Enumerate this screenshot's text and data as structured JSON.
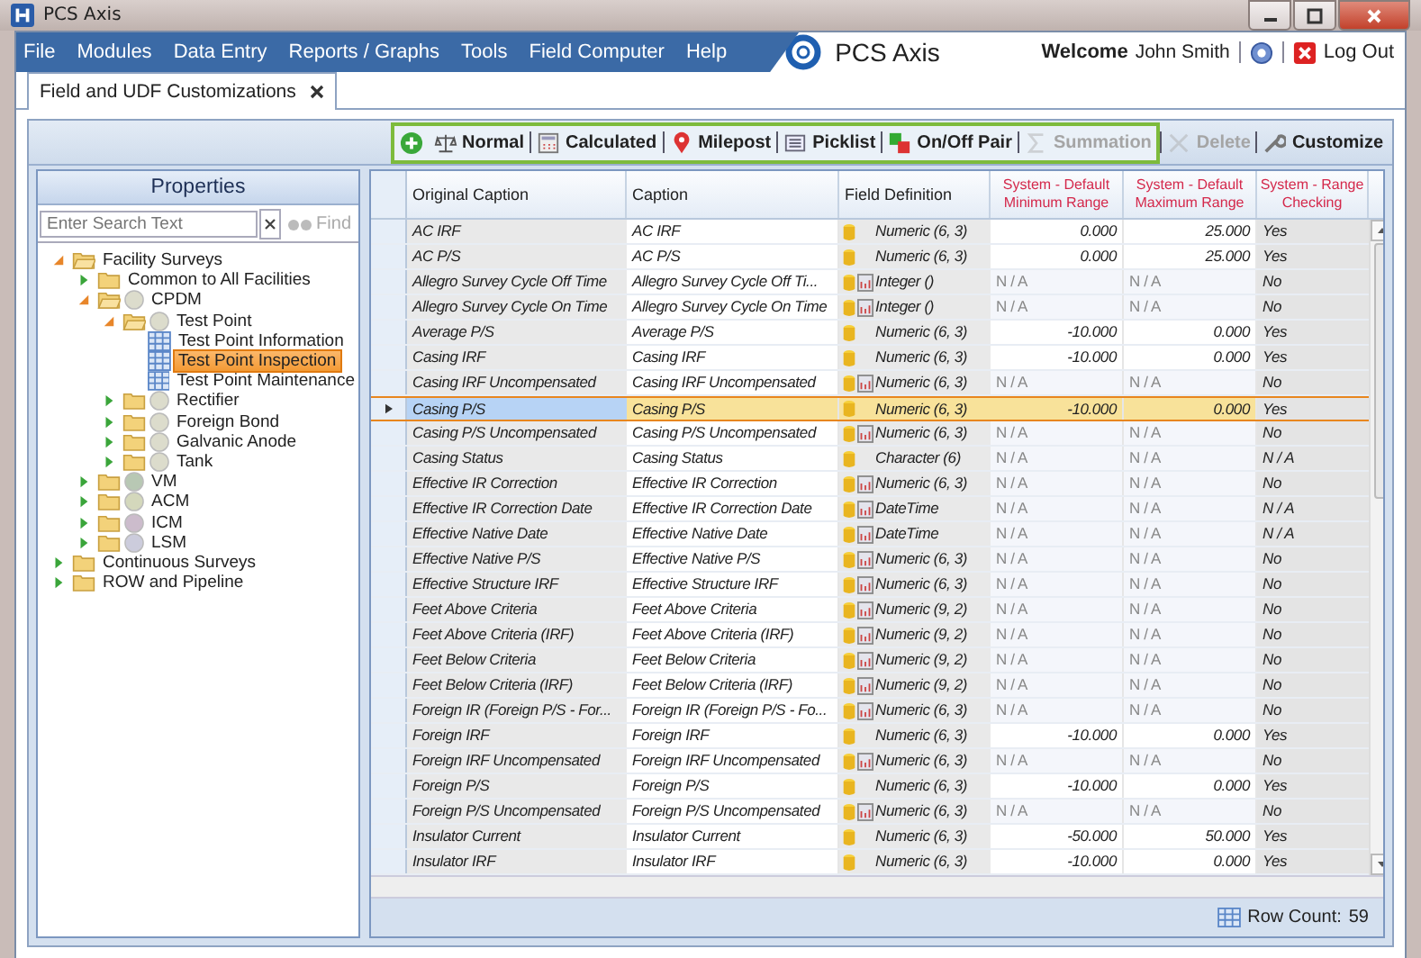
{
  "window": {
    "title": "PCS Axis"
  },
  "menu": [
    "File",
    "Modules",
    "Data Entry",
    "Reports / Graphs",
    "Tools",
    "Field Computer",
    "Help"
  ],
  "brand": "PCS Axis",
  "welcome": {
    "label": "Welcome",
    "user": "John Smith"
  },
  "logout": "Log Out",
  "tabs": [
    {
      "label": "Field and UDF Customizations",
      "selected": true
    }
  ],
  "toolbar": {
    "group": [
      {
        "kind": "add",
        "disabled": false
      },
      {
        "kind": "normal",
        "label": "Normal",
        "disabled": false
      },
      {
        "kind": "calculated",
        "label": "Calculated",
        "disabled": false
      },
      {
        "kind": "milepost",
        "label": "Milepost",
        "disabled": false
      },
      {
        "kind": "picklist",
        "label": "Picklist",
        "disabled": false
      },
      {
        "kind": "onoff",
        "label": "On/Off Pair",
        "disabled": false
      },
      {
        "kind": "summation",
        "label": "Summation",
        "disabled": true
      }
    ],
    "items": [
      {
        "kind": "delete",
        "label": "Delete",
        "disabled": true
      },
      {
        "kind": "customize",
        "label": "Customize",
        "disabled": false
      }
    ]
  },
  "properties": {
    "title": "Properties",
    "search": {
      "placeholder": "Enter Search Text"
    },
    "find": "Find",
    "tree": [
      {
        "label": "Facility Surveys",
        "kind": "folder",
        "expanded": true,
        "selected": false,
        "children": [
          {
            "label": "Common to All Facilities",
            "kind": "folder",
            "expanded": false,
            "selected": false
          },
          {
            "label": "CPDM",
            "kind": "folder",
            "color": "#dcdccc",
            "expanded": true,
            "selected": false,
            "children": [
              {
                "label": "Test Point",
                "kind": "folder",
                "color": "#dcdccc",
                "expanded": true,
                "selected": false,
                "children": [
                  {
                    "label": "Test Point Information",
                    "kind": "table",
                    "selected": false
                  },
                  {
                    "label": "Test Point Inspection",
                    "kind": "table",
                    "selected": true
                  },
                  {
                    "label": "Test Point Maintenance",
                    "kind": "table",
                    "selected": false
                  }
                ]
              },
              {
                "label": "Rectifier",
                "kind": "folder",
                "color": "#dcdccc",
                "expanded": false,
                "selected": false
              },
              {
                "label": "Foreign Bond",
                "kind": "folder",
                "color": "#dcdccc",
                "expanded": false,
                "selected": false
              },
              {
                "label": "Galvanic Anode",
                "kind": "folder",
                "color": "#dcdccc",
                "expanded": false,
                "selected": false
              },
              {
                "label": "Tank",
                "kind": "folder",
                "color": "#dcdccc",
                "expanded": false,
                "selected": false
              }
            ]
          },
          {
            "label": "VM",
            "kind": "folder",
            "color": "#b8c8b4",
            "expanded": false,
            "selected": false
          },
          {
            "label": "ACM",
            "kind": "folder",
            "color": "#d4d8bc",
            "expanded": false,
            "selected": false
          },
          {
            "label": "ICM",
            "kind": "folder",
            "color": "#ccbccc",
            "expanded": false,
            "selected": false
          },
          {
            "label": "LSM",
            "kind": "folder",
            "color": "#ccccdc",
            "expanded": false,
            "selected": false
          }
        ]
      },
      {
        "label": "Continuous Surveys",
        "kind": "folder",
        "expanded": false,
        "selected": false
      },
      {
        "label": "ROW and Pipeline",
        "kind": "folder",
        "expanded": false,
        "selected": false
      }
    ]
  },
  "grid": {
    "columns": [
      {
        "label": "Original Caption",
        "system": false
      },
      {
        "label": "Caption",
        "system": false
      },
      {
        "label": "Field Definition",
        "system": false
      },
      {
        "label": "System - Default Minimum Range",
        "system": true
      },
      {
        "label": "System - Default Maximum Range",
        "system": true
      },
      {
        "label": "System - Range Checking",
        "system": true
      }
    ],
    "rows": [
      {
        "original": "AC IRF",
        "caption": "AC IRF",
        "definition": "Numeric (6, 3)",
        "calculated": false,
        "has_range": true,
        "min": "0.000",
        "max": "25.000",
        "check": "Yes",
        "selected": false
      },
      {
        "original": "AC P/S",
        "caption": "AC P/S",
        "definition": "Numeric (6, 3)",
        "calculated": false,
        "has_range": true,
        "min": "0.000",
        "max": "25.000",
        "check": "Yes",
        "selected": false
      },
      {
        "original": "Allegro Survey Cycle Off Time",
        "caption": "Allegro Survey Cycle Off Ti...",
        "definition": "Integer ()",
        "calculated": true,
        "has_range": false,
        "min": "N / A",
        "max": "N / A",
        "check": "No",
        "selected": false
      },
      {
        "original": "Allegro Survey Cycle On Time",
        "caption": "Allegro Survey Cycle On Time",
        "definition": "Integer ()",
        "calculated": true,
        "has_range": false,
        "min": "N / A",
        "max": "N / A",
        "check": "No",
        "selected": false
      },
      {
        "original": "Average P/S",
        "caption": "Average P/S",
        "definition": "Numeric (6, 3)",
        "calculated": false,
        "has_range": true,
        "min": "-10.000",
        "max": "0.000",
        "check": "Yes",
        "selected": false
      },
      {
        "original": "Casing IRF",
        "caption": "Casing IRF",
        "definition": "Numeric (6, 3)",
        "calculated": false,
        "has_range": true,
        "min": "-10.000",
        "max": "0.000",
        "check": "Yes",
        "selected": false
      },
      {
        "original": "Casing IRF Uncompensated",
        "caption": "Casing IRF Uncompensated",
        "definition": "Numeric (6, 3)",
        "calculated": true,
        "has_range": false,
        "min": "N / A",
        "max": "N / A",
        "check": "No",
        "selected": false
      },
      {
        "original": "Casing P/S",
        "caption": "Casing P/S",
        "definition": "Numeric (6, 3)",
        "calculated": false,
        "has_range": true,
        "min": "-10.000",
        "max": "0.000",
        "check": "Yes",
        "selected": true
      },
      {
        "original": "Casing P/S Uncompensated",
        "caption": "Casing P/S Uncompensated",
        "definition": "Numeric (6, 3)",
        "calculated": true,
        "has_range": false,
        "min": "N / A",
        "max": "N / A",
        "check": "No",
        "selected": false
      },
      {
        "original": "Casing Status",
        "caption": "Casing Status",
        "definition": "Character (6)",
        "calculated": false,
        "has_range": false,
        "min": "N / A",
        "max": "N / A",
        "check": "N / A",
        "selected": false
      },
      {
        "original": "Effective IR Correction",
        "caption": "Effective IR Correction",
        "definition": "Numeric (6, 3)",
        "calculated": true,
        "has_range": false,
        "min": "N / A",
        "max": "N / A",
        "check": "No",
        "selected": false
      },
      {
        "original": "Effective IR Correction Date",
        "caption": "Effective IR Correction Date",
        "definition": "DateTime",
        "calculated": true,
        "has_range": false,
        "min": "N / A",
        "max": "N / A",
        "check": "N / A",
        "selected": false
      },
      {
        "original": "Effective Native Date",
        "caption": "Effective Native Date",
        "definition": "DateTime",
        "calculated": true,
        "has_range": false,
        "min": "N / A",
        "max": "N / A",
        "check": "N / A",
        "selected": false
      },
      {
        "original": "Effective Native P/S",
        "caption": "Effective Native P/S",
        "definition": "Numeric (6, 3)",
        "calculated": true,
        "has_range": false,
        "min": "N / A",
        "max": "N / A",
        "check": "No",
        "selected": false
      },
      {
        "original": "Effective Structure IRF",
        "caption": "Effective Structure IRF",
        "definition": "Numeric (6, 3)",
        "calculated": true,
        "has_range": false,
        "min": "N / A",
        "max": "N / A",
        "check": "No",
        "selected": false
      },
      {
        "original": "Feet Above Criteria",
        "caption": "Feet Above Criteria",
        "definition": "Numeric (9, 2)",
        "calculated": true,
        "has_range": false,
        "min": "N / A",
        "max": "N / A",
        "check": "No",
        "selected": false
      },
      {
        "original": "Feet Above Criteria (IRF)",
        "caption": "Feet Above Criteria (IRF)",
        "definition": "Numeric (9, 2)",
        "calculated": true,
        "has_range": false,
        "min": "N / A",
        "max": "N / A",
        "check": "No",
        "selected": false
      },
      {
        "original": "Feet Below Criteria",
        "caption": "Feet Below Criteria",
        "definition": "Numeric (9, 2)",
        "calculated": true,
        "has_range": false,
        "min": "N / A",
        "max": "N / A",
        "check": "No",
        "selected": false
      },
      {
        "original": "Feet Below Criteria (IRF)",
        "caption": "Feet Below Criteria (IRF)",
        "definition": "Numeric (9, 2)",
        "calculated": true,
        "has_range": false,
        "min": "N / A",
        "max": "N / A",
        "check": "No",
        "selected": false
      },
      {
        "original": "Foreign IR (Foreign P/S - For...",
        "caption": "Foreign IR (Foreign P/S - Fo...",
        "definition": "Numeric (6, 3)",
        "calculated": true,
        "has_range": false,
        "min": "N / A",
        "max": "N / A",
        "check": "No",
        "selected": false
      },
      {
        "original": "Foreign IRF",
        "caption": "Foreign IRF",
        "definition": "Numeric (6, 3)",
        "calculated": false,
        "has_range": true,
        "min": "-10.000",
        "max": "0.000",
        "check": "Yes",
        "selected": false
      },
      {
        "original": "Foreign IRF Uncompensated",
        "caption": "Foreign IRF Uncompensated",
        "definition": "Numeric (6, 3)",
        "calculated": true,
        "has_range": false,
        "min": "N / A",
        "max": "N / A",
        "check": "No",
        "selected": false
      },
      {
        "original": "Foreign P/S",
        "caption": "Foreign P/S",
        "definition": "Numeric (6, 3)",
        "calculated": false,
        "has_range": true,
        "min": "-10.000",
        "max": "0.000",
        "check": "Yes",
        "selected": false
      },
      {
        "original": "Foreign P/S Uncompensated",
        "caption": "Foreign P/S Uncompensated",
        "definition": "Numeric (6, 3)",
        "calculated": true,
        "has_range": false,
        "min": "N / A",
        "max": "N / A",
        "check": "No",
        "selected": false
      },
      {
        "original": "Insulator Current",
        "caption": "Insulator Current",
        "definition": "Numeric (6, 3)",
        "calculated": false,
        "has_range": true,
        "min": "-50.000",
        "max": "50.000",
        "check": "Yes",
        "selected": false
      },
      {
        "original": "Insulator IRF",
        "caption": "Insulator IRF",
        "definition": "Numeric (6, 3)",
        "calculated": false,
        "has_range": true,
        "min": "-10.000",
        "max": "0.000",
        "check": "Yes",
        "selected": false
      }
    ]
  },
  "status": {
    "label": "Row Count:",
    "value": "59"
  }
}
